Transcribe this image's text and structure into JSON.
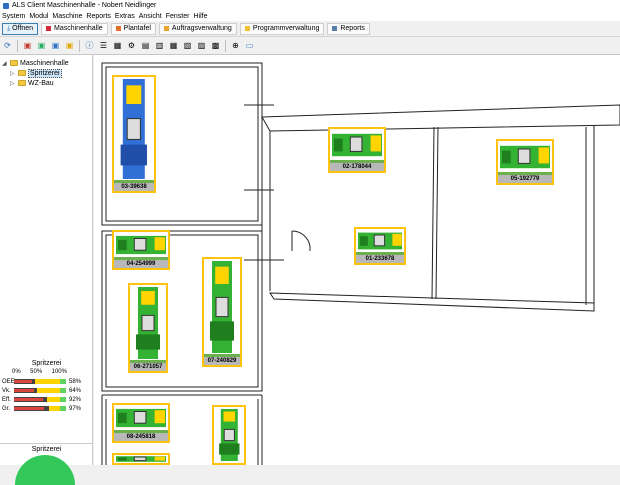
{
  "window": {
    "title": "ALS Client Maschinenhalle - Nobert Neidlinger"
  },
  "menu": [
    "System",
    "Modul",
    "Maschine",
    "Reports",
    "Extras",
    "Ansicht",
    "Fenster",
    "Hilfe"
  ],
  "toolbar": {
    "open_label": "Öffnen",
    "tabs": [
      {
        "label": "Maschinenhalle",
        "color": "#d62c3a"
      },
      {
        "label": "Plantafel",
        "color": "#e8702a"
      },
      {
        "label": "Auftragsverwaltung",
        "color": "#e8a72a"
      },
      {
        "label": "Programmverwaltung",
        "color": "#f2c12e"
      },
      {
        "label": "Reports",
        "color": "#5a7fa6"
      }
    ]
  },
  "tree": {
    "root": "Maschinenhalle",
    "children": [
      "Spritzerei",
      "WZ-Bau"
    ]
  },
  "kpi": {
    "title": "Spritzerei",
    "scale": [
      "0%",
      "50%",
      "100%"
    ],
    "rows": [
      {
        "label": "OEE",
        "value": "58%",
        "fraction": 0.58
      },
      {
        "label": "Vk.",
        "value": "64%",
        "fraction": 0.64
      },
      {
        "label": "Eff.",
        "value": "92%",
        "fraction": 0.92
      },
      {
        "label": "Gr.",
        "value": "97%",
        "fraction": 0.97
      }
    ],
    "second_title": "Spritzerei"
  },
  "machines": [
    {
      "id": "03-39638",
      "status": "blue",
      "orientation": "vertical"
    },
    {
      "id": "02-178044",
      "status": "green",
      "orientation": "horizontal"
    },
    {
      "id": "05-192779",
      "status": "green",
      "orientation": "horizontal"
    },
    {
      "id": "04-254999",
      "status": "green",
      "orientation": "horizontal"
    },
    {
      "id": "01-233678",
      "status": "green",
      "orientation": "horizontal"
    },
    {
      "id": "06-271057",
      "status": "green",
      "orientation": "vertical"
    },
    {
      "id": "07-240829",
      "status": "green",
      "orientation": "vertical"
    },
    {
      "id": "08-245818",
      "status": "green",
      "orientation": "horizontal"
    },
    {
      "id": "",
      "status": "green",
      "orientation": "vertical"
    },
    {
      "id": "",
      "status": "green",
      "orientation": "horizontal"
    }
  ]
}
